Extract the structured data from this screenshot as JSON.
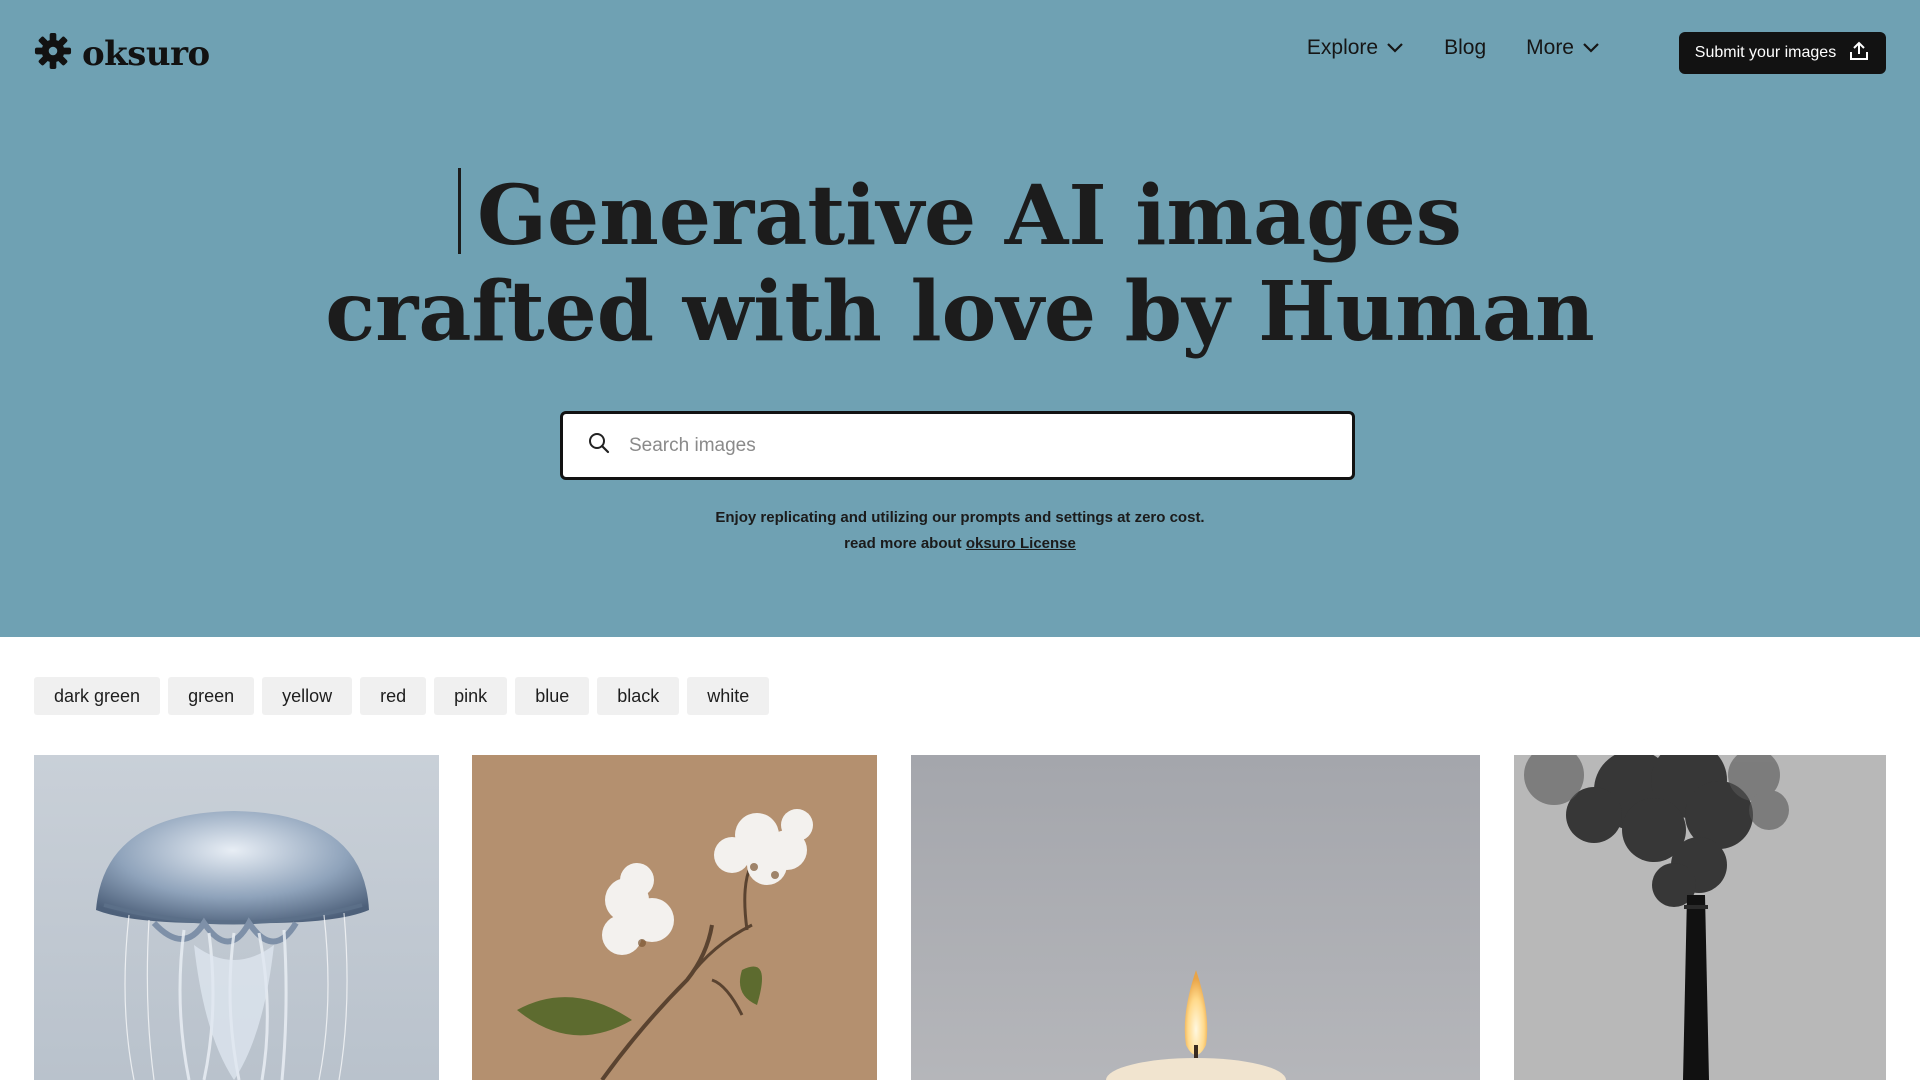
{
  "brand": {
    "name": "oksuro",
    "icon": "gear-icon"
  },
  "nav": {
    "items": [
      {
        "label": "Explore",
        "icon": "chevron-down-icon"
      },
      {
        "label": "Blog"
      },
      {
        "label": "More",
        "icon": "chevron-down-icon"
      }
    ],
    "submit_label": "Submit your images",
    "submit_icon": "upload-icon"
  },
  "hero": {
    "line1": "Generative AI images",
    "line2": "crafted with love by Human",
    "background": "#6fa1b3"
  },
  "search": {
    "placeholder": "Search images",
    "icon": "search-icon"
  },
  "notice": {
    "line1": "Enjoy replicating and utilizing our prompts and settings at zero cost.",
    "line2_prefix": "read more about ",
    "license_link": "oksuro License"
  },
  "color_tags": [
    "dark green",
    "green",
    "yellow",
    "red",
    "pink",
    "blue",
    "black",
    "white"
  ],
  "gallery": [
    {
      "subject": "jellyfish"
    },
    {
      "subject": "cotton flower"
    },
    {
      "subject": "candle"
    },
    {
      "subject": "smokestack"
    }
  ]
}
